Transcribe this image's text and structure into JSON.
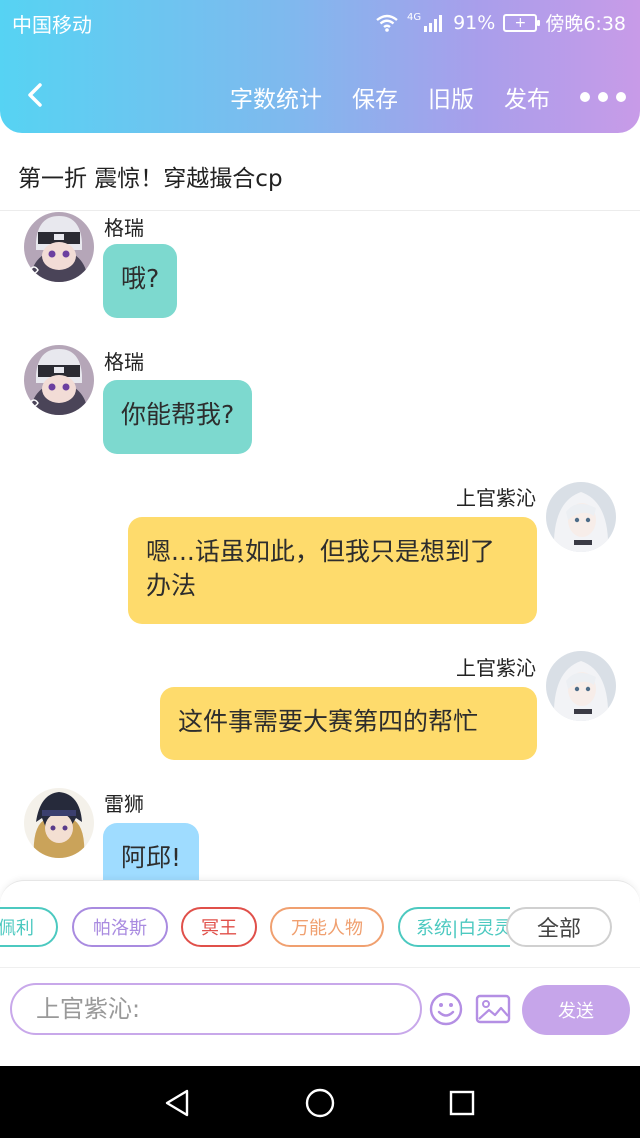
{
  "status_bar": {
    "carrier": "中国移动",
    "network": "4G",
    "battery_percent": "91%",
    "time": "傍晚6:38"
  },
  "toolbar": {
    "back_icon": "chevron-left-icon",
    "word_count_label": "字数统计",
    "save_label": "保存",
    "old_version_label": "旧版",
    "publish_label": "发布",
    "more_icon": "more-dots-icon"
  },
  "title": "第一折 震惊！穿越撮合cp",
  "messages": [
    {
      "sender": "格瑞",
      "text": "哦?",
      "side": "left",
      "color": "#7dd9cf"
    },
    {
      "sender": "格瑞",
      "text": "你能帮我?",
      "side": "left",
      "color": "#7dd9cf"
    },
    {
      "sender": "上官紫沁",
      "text": "嗯...话虽如此，但我只是想到了办法",
      "side": "right",
      "color": "#fedb6c"
    },
    {
      "sender": "上官紫沁",
      "text": "这件事需要大赛第四的帮忙",
      "side": "right",
      "color": "#fedb6c"
    },
    {
      "sender": "雷狮",
      "text": "阿邱!",
      "side": "left",
      "color": "#9fdcff"
    }
  ],
  "role_tags": [
    {
      "label": "佩利",
      "color": "#4cc9c0"
    },
    {
      "label": "帕洛斯",
      "color": "#a98be0"
    },
    {
      "label": "冥王",
      "color": "#e0504a"
    },
    {
      "label": "万能人物",
      "color": "#f0a070"
    },
    {
      "label": "系统|白灵灵",
      "color": "#4cc9c0"
    }
  ],
  "all_label": "全部",
  "input": {
    "placeholder": "上官紫沁:",
    "emoji_icon": "smiley-icon",
    "image_icon": "image-icon",
    "send_label": "发送"
  },
  "nav": {
    "back_icon": "nav-back-triangle-icon",
    "home_icon": "nav-home-circle-icon",
    "recents_icon": "nav-recents-square-icon"
  }
}
